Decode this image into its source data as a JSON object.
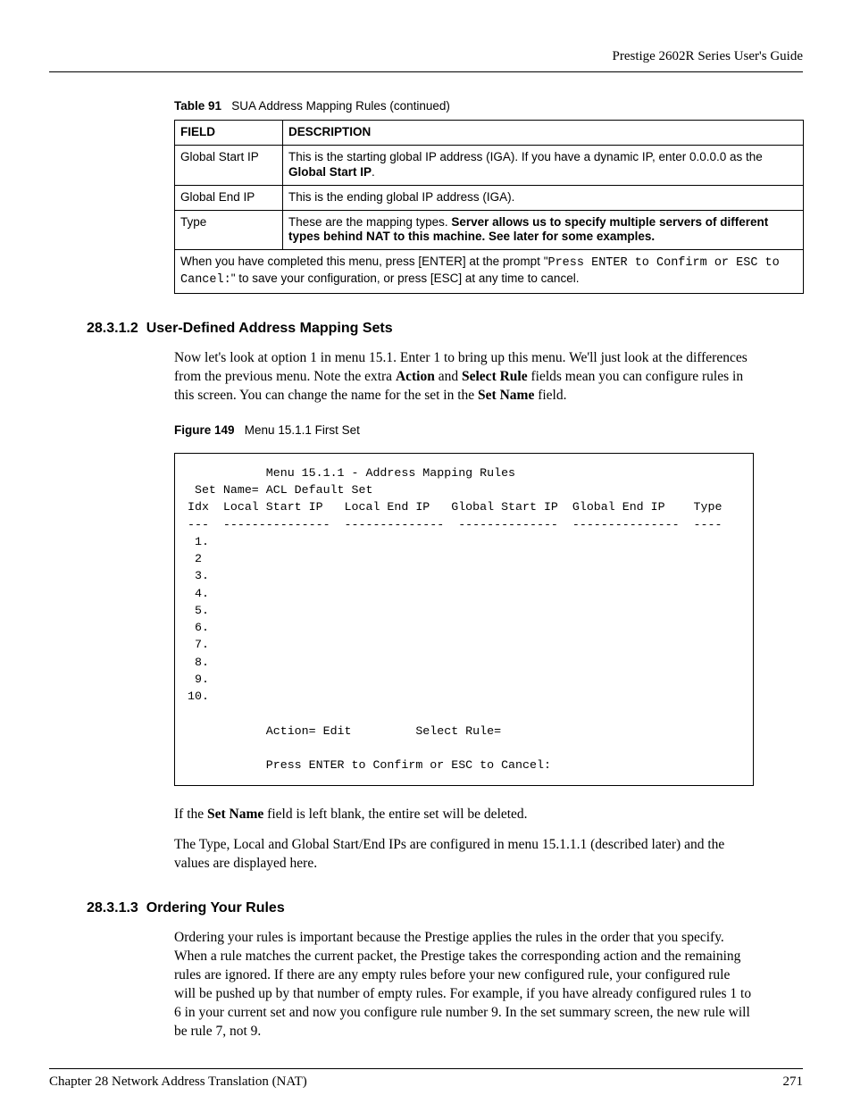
{
  "running_head": "Prestige 2602R Series User's Guide",
  "table_caption_label": "Table 91",
  "table_caption_text": "SUA Address Mapping Rules (continued)",
  "table": {
    "headers": {
      "field": "FIELD",
      "description": "DESCRIPTION"
    },
    "rows": [
      {
        "field": "Global Start IP",
        "desc_pre": "This is the starting global IP address (IGA). If you have a dynamic IP, enter 0.0.0.0 as the ",
        "desc_bold": "Global Start IP",
        "desc_post": "."
      },
      {
        "field": "Global End IP",
        "desc_pre": "This is the ending global IP address (IGA).",
        "desc_bold": "",
        "desc_post": ""
      },
      {
        "field": "Type",
        "desc_pre": "These are the mapping types. ",
        "desc_bold": "Server allows us to specify multiple servers of different types behind NAT to this machine. See later for some examples.",
        "desc_post": ""
      }
    ],
    "footer_pre": "When you have completed this menu, press [ENTER] at the prompt \"",
    "footer_mono": "Press ENTER to Confirm or ESC to Cancel:",
    "footer_post": "\" to save your configuration, or press [ESC] at any time to cancel."
  },
  "section_1_num": "28.3.1.2",
  "section_1_title": "User-Defined Address Mapping Sets",
  "para_1_a": "Now let's look at option 1 in menu 15.1. Enter 1 to bring up this menu. We'll just look at the differences from the previous menu. Note the extra ",
  "para_1_b": "Action",
  "para_1_c": " and ",
  "para_1_d": "Select Rule",
  "para_1_e": " fields mean you can configure rules in this screen. You can change the name for the set in the ",
  "para_1_f": "Set Name",
  "para_1_g": " field.",
  "figure_label": "Figure 149",
  "figure_text": "Menu 15.1.1 First Set",
  "terminal": "            Menu 15.1.1 - Address Mapping Rules\n  Set Name= ACL Default Set\n Idx  Local Start IP   Local End IP   Global Start IP  Global End IP    Type\n ---  ---------------  --------------  --------------  ---------------  ----\n  1.\n  2\n  3.\n  4.\n  5.\n  6.\n  7.\n  8.\n  9.\n 10.\n\n            Action= Edit         Select Rule=\n\n            Press ENTER to Confirm or ESC to Cancel:",
  "para_2_a": "If the ",
  "para_2_b": "Set Name",
  "para_2_c": " field is left blank, the entire set will be deleted.",
  "para_3": "The Type, Local and Global Start/End IPs are configured in menu 15.1.1.1 (described later) and the values are displayed here.",
  "section_2_num": "28.3.1.3",
  "section_2_title": "Ordering Your Rules",
  "para_4": "Ordering your rules is important because the Prestige applies the rules in the order that you specify. When a rule matches the current packet, the Prestige takes the corresponding action and the remaining rules are ignored. If there are any empty rules before your new configured rule, your configured rule will be pushed up by that number of empty rules. For example, if you have already configured rules 1 to 6 in your current set and now you configure rule number 9. In the set summary screen, the new rule will be rule 7, not 9.",
  "footer_left": "Chapter 28 Network Address Translation (NAT)",
  "footer_right": "271"
}
